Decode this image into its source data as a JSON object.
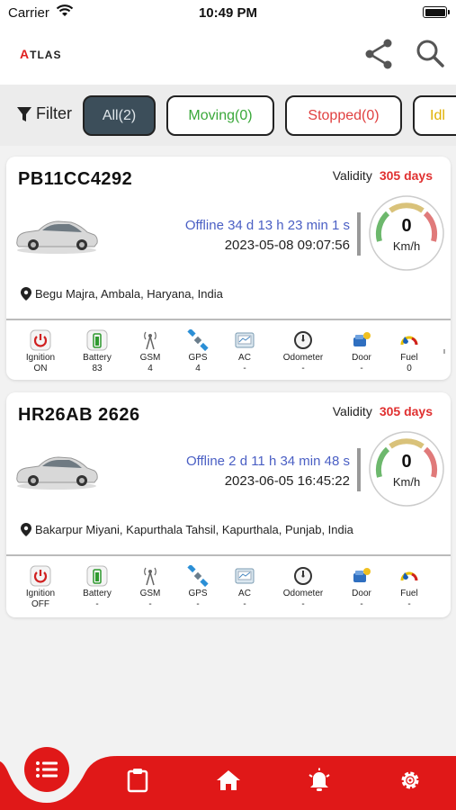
{
  "status_bar": {
    "carrier": "Carrier",
    "time": "10:49 PM"
  },
  "header": {
    "logo_text": "TLAS",
    "logo_accent": "A"
  },
  "filter": {
    "label": "Filter",
    "chips": [
      {
        "label": "All(2)",
        "color": "#3c4e5a"
      },
      {
        "label": "Moving(0)",
        "color": "#3aa83a"
      },
      {
        "label": "Stopped(0)",
        "color": "#e04040"
      },
      {
        "label": "Idl",
        "color": "#e0b000"
      }
    ]
  },
  "vehicles": [
    {
      "plate": "PB11CC4292",
      "validity_label": "Validity",
      "validity_days": "305 days",
      "status": "Offline 34 d 13 h 23 min 1 s",
      "datetime": "2023-05-08 09:07:56",
      "speed": "0",
      "speed_unit": "Km/h",
      "location": "Begu Majra, Ambala, Haryana, India",
      "sensors": {
        "ignition": {
          "label": "Ignition",
          "value": "ON"
        },
        "battery": {
          "label": "Battery",
          "value": "83"
        },
        "gsm": {
          "label": "GSM",
          "value": "4"
        },
        "gps": {
          "label": "GPS",
          "value": "4"
        },
        "ac": {
          "label": "AC",
          "value": "-"
        },
        "odometer": {
          "label": "Odometer",
          "value": "-"
        },
        "door": {
          "label": "Door",
          "value": "-"
        },
        "fuel": {
          "label": "Fuel",
          "value": "0"
        }
      }
    },
    {
      "plate": "HR26AB 2626",
      "validity_label": "Validity",
      "validity_days": "305 days",
      "status": "Offline 2 d 11 h 34 min 48 s",
      "datetime": "2023-06-05 16:45:22",
      "speed": "0",
      "speed_unit": "Km/h",
      "location": "Bakarpur Miyani, Kapurthala Tahsil, Kapurthala, Punjab, India",
      "sensors": {
        "ignition": {
          "label": "Ignition",
          "value": "OFF"
        },
        "battery": {
          "label": "Battery",
          "value": "-"
        },
        "gsm": {
          "label": "GSM",
          "value": "-"
        },
        "gps": {
          "label": "GPS",
          "value": "-"
        },
        "ac": {
          "label": "AC",
          "value": "-"
        },
        "odometer": {
          "label": "Odometer",
          "value": "-"
        },
        "door": {
          "label": "Door",
          "value": "-"
        },
        "fuel": {
          "label": "Fuel",
          "value": "-"
        }
      }
    }
  ],
  "bottom_nav": {
    "items": [
      {
        "icon": "list-menu-icon"
      },
      {
        "icon": "clipboard-icon"
      },
      {
        "icon": "home-icon"
      },
      {
        "icon": "alarm-bell-icon"
      },
      {
        "icon": "gear-icon"
      }
    ],
    "accent": "#e01818"
  }
}
